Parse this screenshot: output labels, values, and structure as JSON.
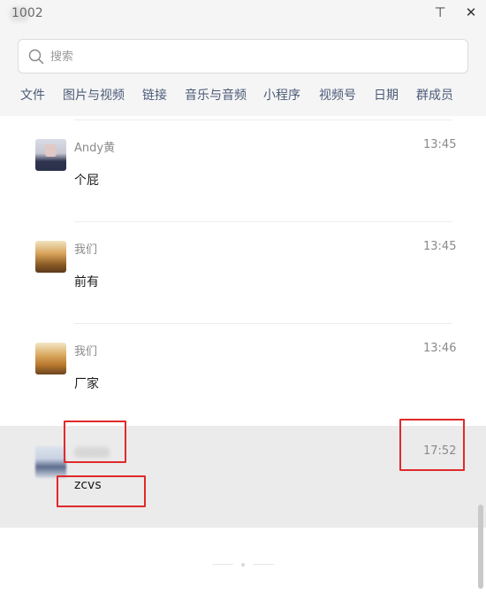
{
  "window": {
    "title": "1002",
    "pin_icon": "pin-icon",
    "close_icon": "close-icon",
    "pin_glyph": "⊤",
    "close_glyph": "✕"
  },
  "search": {
    "placeholder": "搜索",
    "icon": "search-icon"
  },
  "tabs": [
    {
      "label": "文件"
    },
    {
      "label": "图片与视频"
    },
    {
      "label": "链接"
    },
    {
      "label": "音乐与音频"
    },
    {
      "label": "小程序"
    },
    {
      "label": "视频号"
    },
    {
      "label": "日期"
    },
    {
      "label": "群成员"
    }
  ],
  "messages": [
    {
      "sender": "Andy黄",
      "time": "13:45",
      "text": "个屁"
    },
    {
      "sender": "我们",
      "time": "13:45",
      "text": "前有"
    },
    {
      "sender": "我们",
      "time": "13:46",
      "text": "厂家"
    },
    {
      "sender": "",
      "time": "17:52",
      "text": "zcvs"
    }
  ],
  "colors": {
    "header_bg": "#f5f5f5",
    "tab_text": "#4a5a78",
    "selected_row": "#ebebeb",
    "highlight_box": "#e02a2a"
  }
}
